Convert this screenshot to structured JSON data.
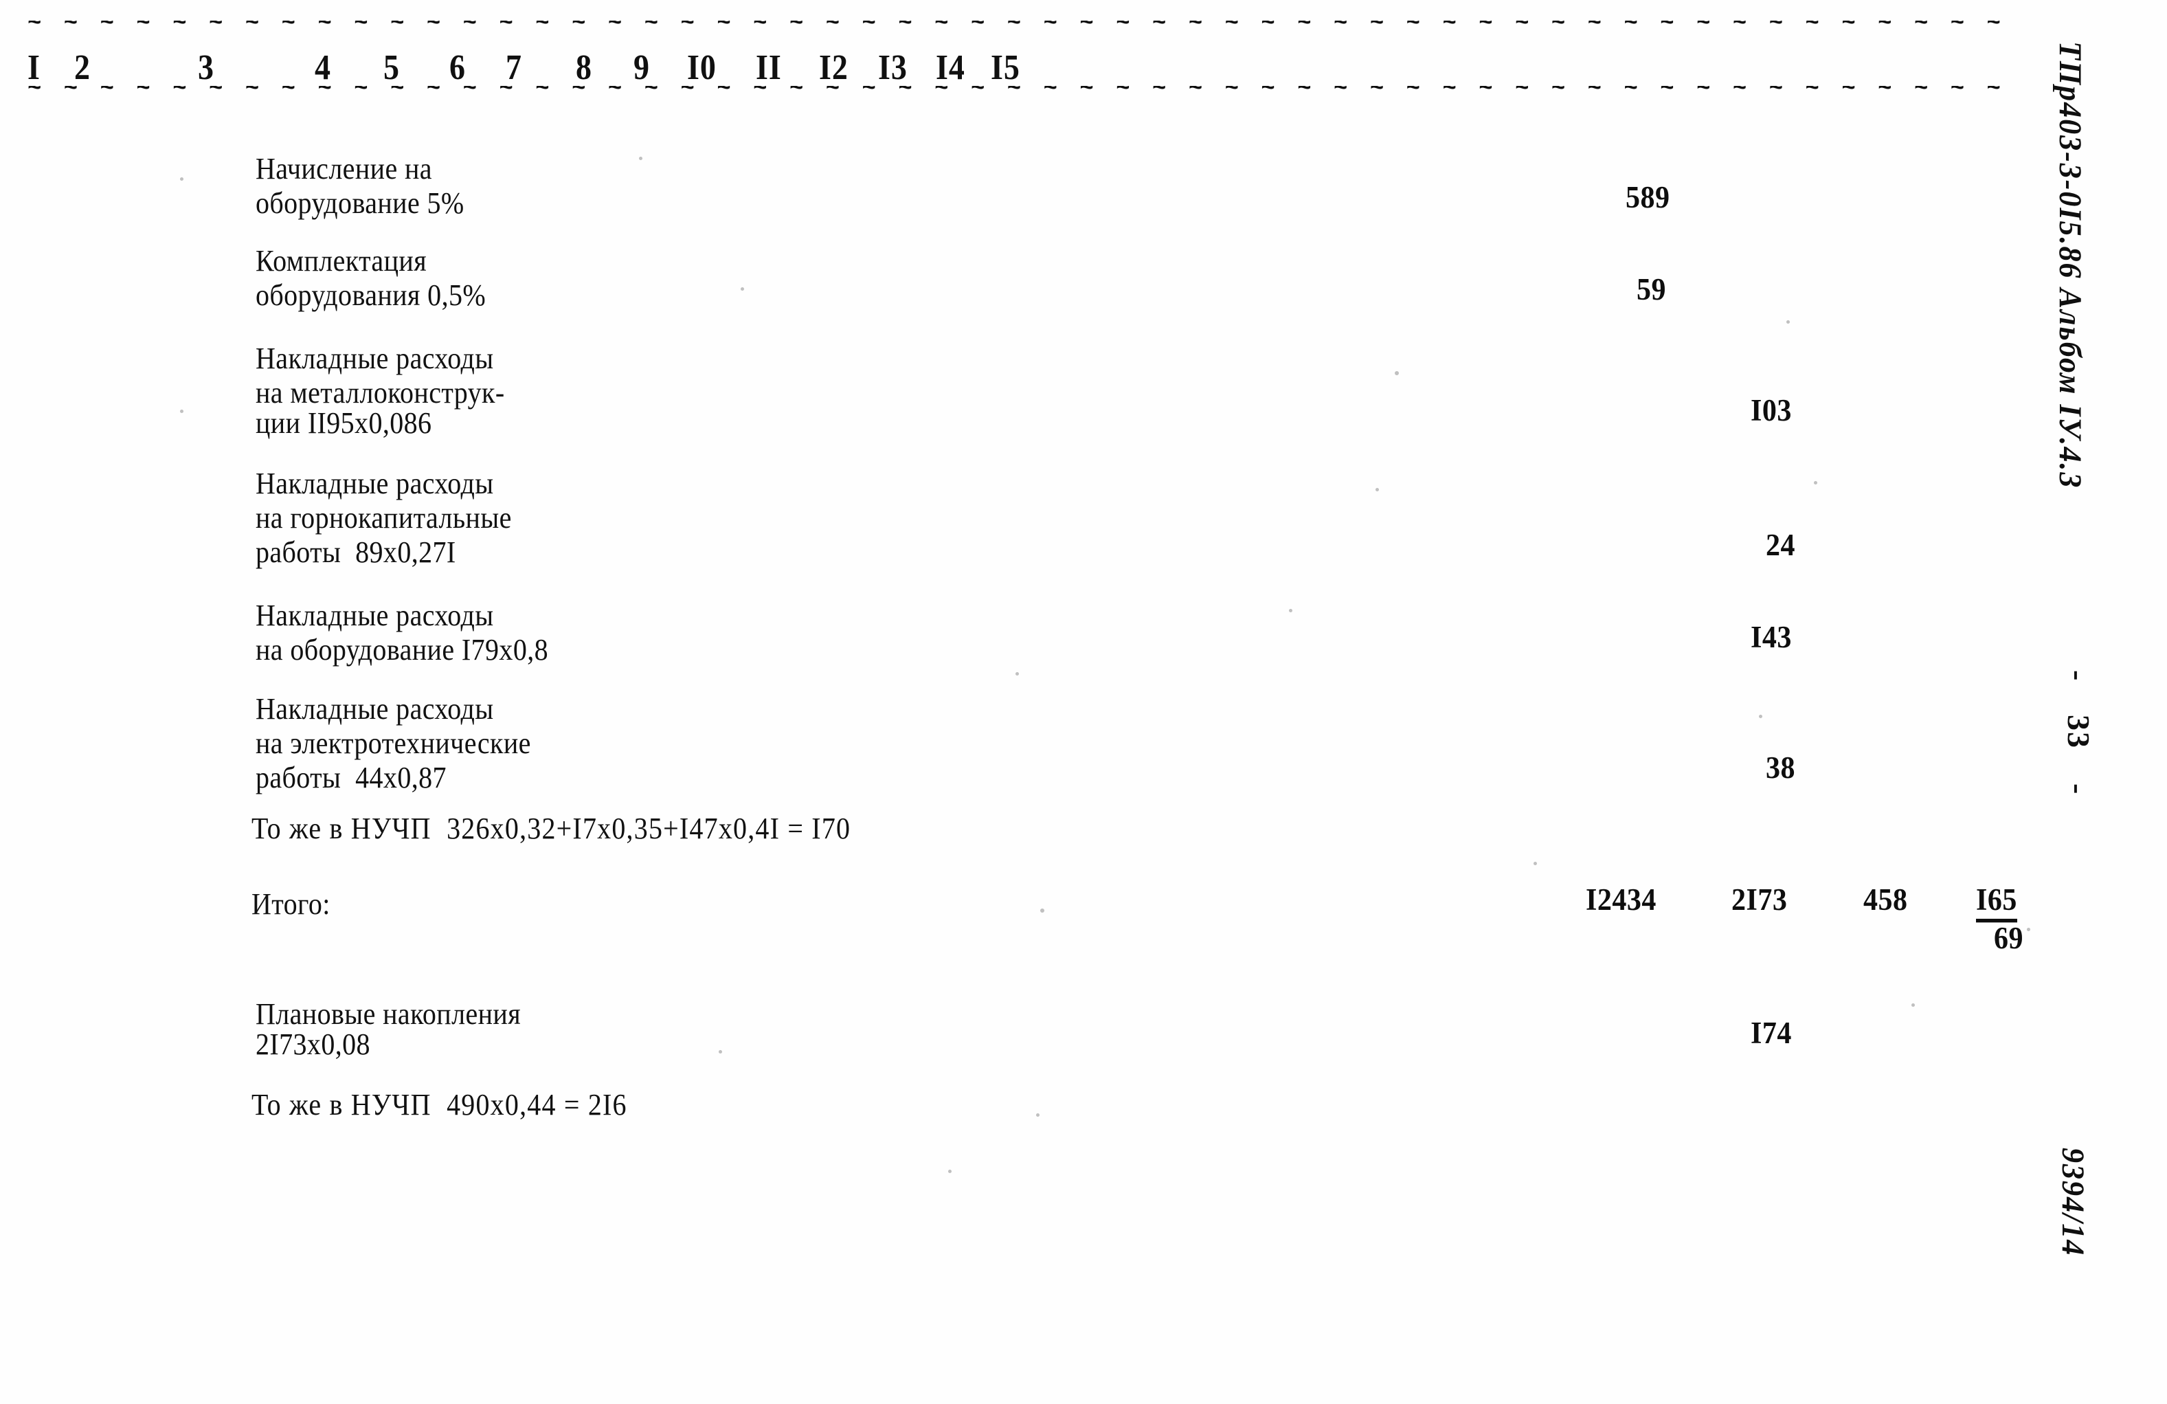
{
  "document": {
    "type": "scanned-estimate-table",
    "page_number": "33"
  },
  "table": {
    "column_headers": [
      "I",
      "2",
      "3",
      "4",
      "5",
      "6",
      "7",
      "8",
      "9",
      "I0",
      "II",
      "I2",
      "I3",
      "I4",
      "I5"
    ],
    "dash_rule_top": "~ ~ ~ ~ ~ ~ ~ ~ ~ ~ ~ ~ ~ ~ ~ ~ ~ ~ ~ ~ ~ ~ ~ ~ ~ ~ ~ ~ ~ ~ ~ ~ ~ ~ ~ ~ ~ ~ ~ ~ ~ ~ ~ ~ ~ ~ ~ ~ ~ ~ ~ ~ ~ ~ ~ ~ ~ ~ ~ ~ ~ ~ ~ ~ ~ ~ ~ ~ ~ ~ ~ ~ ~ ~ ~ ~ ~ ~ ~ ~ ~ ~ ~ ~",
    "dash_rule_bottom": "~ ~ ~ ~ ~ ~ ~ ~ ~ ~ ~ ~ ~ ~ ~ ~ ~ ~ ~ ~ ~ ~ ~ ~ ~ ~ ~ ~ ~ ~ ~ ~ ~ ~ ~ ~ ~ ~ ~ ~ ~ ~ ~ ~ ~ ~ ~ ~ ~ ~ ~ ~ ~ ~ ~ ~ ~ ~ ~ ~ ~ ~ ~ ~ ~ ~ ~ ~ ~ ~ ~ ~ ~ ~ ~ ~ ~ ~ ~ ~ ~ ~ ~ ~",
    "rows": [
      {
        "id": "row-nachislenie",
        "description_lines": [
          "Начисление на",
          "оборудование 5%"
        ],
        "col12": "589"
      },
      {
        "id": "row-komplektaciya",
        "description_lines": [
          "Комплектация",
          "оборудования 0,5%"
        ],
        "col12": "59"
      },
      {
        "id": "row-nakladnye-metallokonstrukcii",
        "description_lines": [
          "Накладные расходы",
          "на металлоконструк-",
          "ции II95х0,086"
        ],
        "col13": "I03"
      },
      {
        "id": "row-nakladnye-gornokapitalnye",
        "description_lines": [
          "Накладные расходы",
          "на горнокапитальные",
          "работы  89х0,27I"
        ],
        "col13": "24"
      },
      {
        "id": "row-nakladnye-oborudovanie",
        "description_lines": [
          "Накладные расходы",
          "на оборудование I79х0,8"
        ],
        "col13": "I43"
      },
      {
        "id": "row-nakladnye-elektrotehnicheskie",
        "description_lines": [
          "Накладные расходы",
          "на электротехнические",
          "работы  44х0,87"
        ],
        "col13": "38"
      },
      {
        "id": "row-tozhe-nuchp-1",
        "description_lines": [
          "То же в НУЧП  326х0,32+I7х0,35+I47х0,4I = I70"
        ]
      },
      {
        "id": "row-itogo",
        "description_lines": [
          "Итого:"
        ],
        "col11": "I2434",
        "col13": "2I73",
        "col14": "458",
        "col15_top": "I65",
        "col15_bottom": "69"
      },
      {
        "id": "row-planovye-nakopleniya",
        "description_lines": [
          "Плановые накопления",
          "2I73х0,08"
        ],
        "col13": "I74"
      },
      {
        "id": "row-tozhe-nuchp-2",
        "description_lines": [
          "То же в НУЧП  490х0,44 = 2I6"
        ]
      }
    ]
  },
  "margin": {
    "album_code": "ТПр403-3-0I5.86 Альбом IУ.4.3",
    "page_dash_top": "-",
    "page_number": "33",
    "page_dash_bottom": "-",
    "drawing_number": "9394/14"
  }
}
